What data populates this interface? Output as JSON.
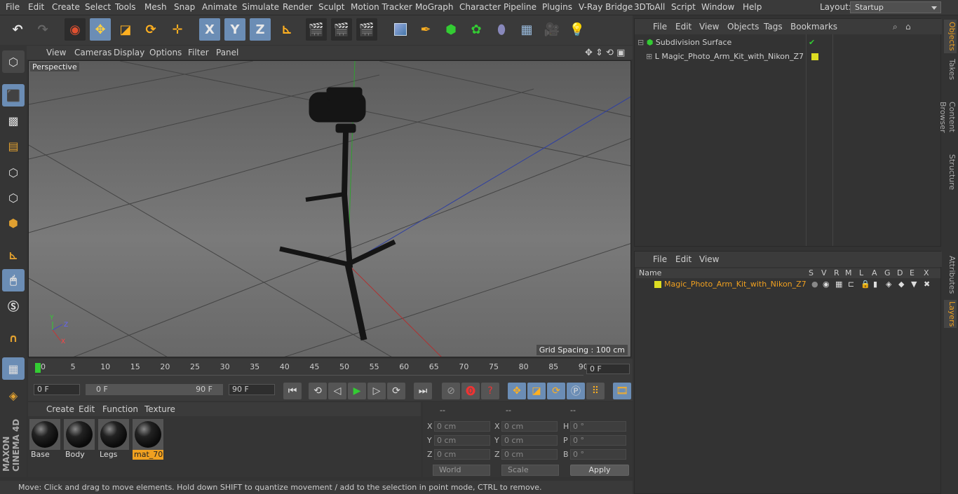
{
  "menubar": {
    "items": [
      "File",
      "Edit",
      "Create",
      "Select",
      "Tools",
      "Mesh",
      "Snap",
      "Animate",
      "Simulate",
      "Render",
      "Sculpt",
      "Motion Tracker",
      "MoGraph",
      "Character",
      "Pipeline",
      "Plugins",
      "V-Ray Bridge",
      "3DToAll",
      "Script",
      "Window",
      "Help"
    ],
    "layout_label": "Layout:",
    "layout_value": "Startup"
  },
  "toolbar": {
    "x_label": "X",
    "y_label": "Y",
    "z_label": "Z"
  },
  "viewport": {
    "menu": [
      "View",
      "Cameras",
      "Display",
      "Options",
      "Filter",
      "Panel"
    ],
    "label": "Perspective",
    "grid_spacing": "Grid Spacing : 100 cm",
    "axis_y": "Y",
    "axis_z": "Z",
    "axis_x": "X"
  },
  "timeline": {
    "ticks": [
      "0",
      "5",
      "10",
      "15",
      "20",
      "25",
      "30",
      "35",
      "40",
      "45",
      "50",
      "55",
      "60",
      "65",
      "70",
      "75",
      "80",
      "85",
      "90"
    ],
    "current_frame": "0 F",
    "start_field": "0 F",
    "range_start": "0 F",
    "range_end": "90 F",
    "end_field": "90 F"
  },
  "materials": {
    "menu": [
      "Create",
      "Edit",
      "Function",
      "Texture"
    ],
    "items": [
      {
        "name": "Base"
      },
      {
        "name": "Body"
      },
      {
        "name": "Legs"
      },
      {
        "name": "mat_70"
      }
    ]
  },
  "coords": {
    "headers": [
      "--",
      "--",
      "--"
    ],
    "x1": "0 cm",
    "y1": "0 cm",
    "z1": "0 cm",
    "x2": "0 cm",
    "y2": "0 cm",
    "z2": "0 cm",
    "h": "0 °",
    "p": "0 °",
    "b": "0 °",
    "labels": {
      "x": "X",
      "y": "Y",
      "z": "Z",
      "h": "H",
      "p": "P",
      "b": "B"
    },
    "world": "World",
    "scale": "Scale",
    "apply": "Apply"
  },
  "status": "Move: Click and drag to move elements. Hold down SHIFT to quantize movement / add to the selection in point mode, CTRL to remove.",
  "objects": {
    "menu": [
      "File",
      "Edit",
      "View",
      "Objects",
      "Tags",
      "Bookmarks"
    ],
    "rows": [
      {
        "name": "Subdivision Surface"
      },
      {
        "name": "Magic_Photo_Arm_Kit_with_Nikon_Z7"
      }
    ]
  },
  "layers": {
    "menu": [
      "File",
      "Edit",
      "View"
    ],
    "headers": [
      "Name",
      "S",
      "V",
      "R",
      "M",
      "L",
      "A",
      "G",
      "D",
      "E",
      "X"
    ],
    "row": "Magic_Photo_Arm_Kit_with_Nikon_Z7"
  },
  "right_tabs": [
    "Objects",
    "Takes",
    "Content Browser",
    "Structure",
    "Attributes",
    "Layers"
  ],
  "colors": {
    "accent": "#6b8db5",
    "highlight": "#f0a020"
  }
}
